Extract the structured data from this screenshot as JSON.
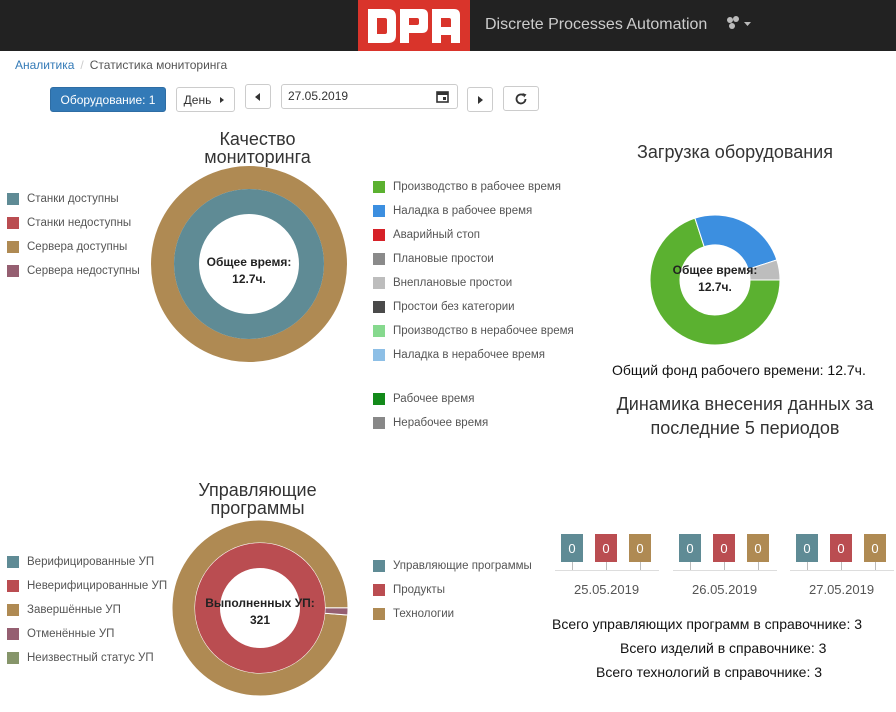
{
  "header": {
    "logo_text": "DPA",
    "brand": "Discrete Processes Automation",
    "user_icon": "users-icon",
    "dropdown_icon": "caret-down-icon"
  },
  "breadcrumb": {
    "root": "Аналитика",
    "current": "Статистика мониторинга"
  },
  "toolbar": {
    "equipment_button": "Оборудование: 1",
    "period_select": "День",
    "date_value": "27.05.2019",
    "prev_icon": "chevron-left-icon",
    "next_icon": "chevron-right-icon",
    "calendar_icon": "calendar-icon",
    "refresh_icon": "refresh-icon"
  },
  "monitoring": {
    "title_line1": "Качество",
    "title_line2": "мониторинга",
    "center_line1": "Общее время:",
    "center_line2": "12.7ч.",
    "legend_left": [
      {
        "label": "Станки доступны",
        "color": "#5f8b95"
      },
      {
        "label": "Станки недоступны",
        "color": "#ba4d51"
      },
      {
        "label": "Сервера доступны",
        "color": "#af8a53"
      },
      {
        "label": "Сервера недоступны",
        "color": "#955f71"
      }
    ],
    "legend_right": [
      {
        "label": "Производство в рабочее время",
        "color": "#5bb130"
      },
      {
        "label": "Наладка в рабочее время",
        "color": "#3c8fe0"
      },
      {
        "label": "Аварийный стоп",
        "color": "#d62128"
      },
      {
        "label": "Плановые простои",
        "color": "#8a8a8a"
      },
      {
        "label": "Внеплановые простои",
        "color": "#bdbdbd"
      },
      {
        "label": "Простои без категории",
        "color": "#4a4a4a"
      },
      {
        "label": "Производство в нерабочее время",
        "color": "#86d98e"
      },
      {
        "label": "Наладка в нерабочее время",
        "color": "#8dbfe6"
      }
    ],
    "legend_right2": [
      {
        "label": "Рабочее время",
        "color": "#138a1a"
      },
      {
        "label": "Нерабочее время",
        "color": "#888888"
      }
    ]
  },
  "load": {
    "title": "Загрузка оборудования",
    "center_line1": "Общее время:",
    "center_line2": "12.7ч.",
    "total_text": "Общий фонд рабочего времени: 12.7ч."
  },
  "dynamics": {
    "title_line1": "Динамика внесения данных за",
    "title_line2": "последние 5 периодов",
    "periods": [
      {
        "date": "25.05.2019",
        "values": [
          "0",
          "0",
          "0"
        ]
      },
      {
        "date": "26.05.2019",
        "values": [
          "0",
          "0",
          "0"
        ]
      },
      {
        "date": "27.05.2019",
        "values": [
          "0",
          "0",
          "0"
        ]
      }
    ],
    "colors": [
      "#5f8b95",
      "#ba4d51",
      "#af8a53"
    ],
    "summary": [
      "Всего управляющих программ в справочнике: 3",
      "Всего изделий в справочнике: 3",
      "Всего технологий в справочнике: 3"
    ]
  },
  "programs": {
    "title_line1": "Управляющие",
    "title_line2": "программы",
    "center_line1": "Выполненных УП:",
    "center_line2": "321",
    "legend_left": [
      {
        "label": "Верифицированные УП",
        "color": "#5f8b95"
      },
      {
        "label": "Неверифицированные УП",
        "color": "#ba4d51"
      },
      {
        "label": "Завершённые УП",
        "color": "#af8a53"
      },
      {
        "label": "Отменённые УП",
        "color": "#955f71"
      },
      {
        "label": "Неизвестный статус УП",
        "color": "#86956a"
      }
    ],
    "legend_right": [
      {
        "label": "Управляющие программы",
        "color": "#5f8b95"
      },
      {
        "label": "Продукты",
        "color": "#ba4d51"
      },
      {
        "label": "Технологии",
        "color": "#af8a53"
      }
    ]
  },
  "chart_data": [
    {
      "type": "pie",
      "title": "Качество мониторинга",
      "series": [
        {
          "name": "Станки доступны",
          "values": [
            100
          ]
        },
        {
          "name": "Сервера доступны",
          "values": [
            100
          ]
        }
      ]
    },
    {
      "type": "pie",
      "title": "Загрузка оборудования",
      "categories": [
        "Производство в рабочее время",
        "Наладка в рабочее время",
        "Внеплановые простои"
      ],
      "values": [
        70,
        25,
        5
      ]
    },
    {
      "type": "pie",
      "title": "Управляющие программы",
      "series": [
        {
          "name": "Неверифицированные УП",
          "values": [
            100
          ]
        },
        {
          "name": "Завершённые УП",
          "values": [
            98.7
          ]
        },
        {
          "name": "Отменённые УП",
          "values": [
            1.3
          ]
        }
      ]
    }
  ]
}
